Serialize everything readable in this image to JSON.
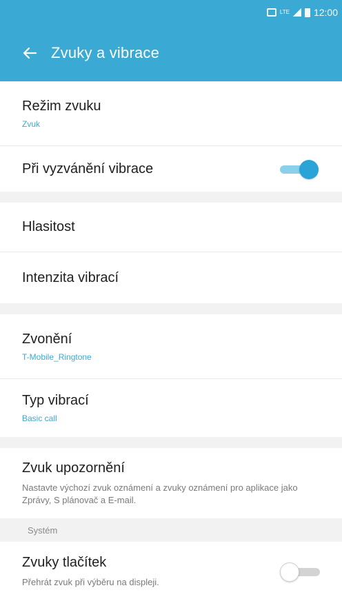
{
  "status_bar": {
    "lte": "LTE",
    "time": "12:00",
    "icons": [
      "nfc-icon",
      "lte-icon",
      "signal-icon",
      "battery-icon"
    ]
  },
  "app_bar": {
    "title": "Zvuky a vibrace",
    "back_icon": "back-arrow-icon"
  },
  "items": {
    "sound_mode": {
      "title": "Režim zvuku",
      "value": "Zvuk"
    },
    "vibrate_when_ringing": {
      "title": "Při vyzvánění vibrace",
      "toggle_on": true
    },
    "volume": {
      "title": "Hlasitost"
    },
    "vibration_intensity": {
      "title": "Intenzita vibrací"
    },
    "ringtone": {
      "title": "Zvonění",
      "value": "T-Mobile_Ringtone"
    },
    "vibration_pattern": {
      "title": "Typ vibrací",
      "value": "Basic call"
    },
    "notification_sound": {
      "title": "Zvuk upozornění",
      "description": "Nastavte výchozí zvuk oznámení a zvuky oznámení pro aplikace jako Zprávy, S plánovač a E-mail."
    },
    "system_header": "Systém",
    "touch_sounds": {
      "title": "Zvuky tlačítek",
      "description": "Přehrát zvuk při výběru na displeji.",
      "toggle_on": false
    }
  },
  "colors": {
    "accent": "#3aa9d4",
    "toggle_on": "#2aa3d6",
    "section_bg": "#f2f2f2"
  }
}
